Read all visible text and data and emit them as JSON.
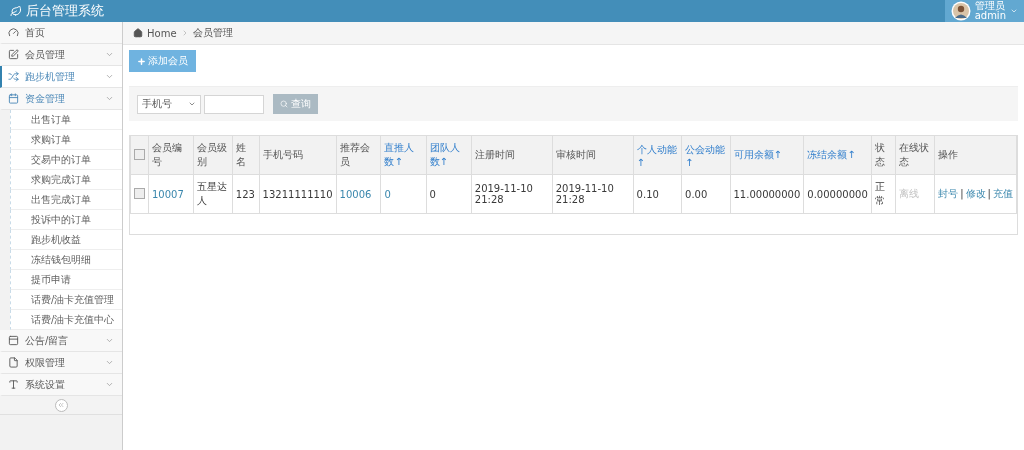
{
  "app": {
    "title": "后台管理系统"
  },
  "user": {
    "role": "管理员",
    "name": "admin"
  },
  "sidebar": {
    "items": [
      {
        "label": "首页",
        "selected": false
      },
      {
        "label": "会员管理",
        "selected": false,
        "expanded": false
      },
      {
        "label": "跑步机管理",
        "selected": true,
        "expanded": false
      },
      {
        "label": "资金管理",
        "selected": false,
        "expanded": true,
        "children": [
          {
            "label": "出售订单"
          },
          {
            "label": "求购订单"
          },
          {
            "label": "交易中的订单"
          },
          {
            "label": "求购完成订单"
          },
          {
            "label": "出售完成订单"
          },
          {
            "label": "投诉中的订单"
          },
          {
            "label": "跑步机收益"
          },
          {
            "label": "冻结钱包明细"
          },
          {
            "label": "提币申请"
          },
          {
            "label": "话费/油卡充值管理"
          },
          {
            "label": "话费/油卡充值中心"
          }
        ]
      },
      {
        "label": "公告/留言",
        "selected": false,
        "expanded": false
      },
      {
        "label": "权限管理",
        "selected": false,
        "expanded": false
      },
      {
        "label": "系统设置",
        "selected": false,
        "expanded": false
      }
    ]
  },
  "breadcrumb": [
    "Home",
    "会员管理"
  ],
  "add_button": "添加会员",
  "search": {
    "field": "手机号",
    "button": "查询"
  },
  "table": {
    "select_all": {
      "checked": false
    },
    "columns": [
      {
        "label": "会员编号",
        "sortable": false
      },
      {
        "label": "会员级别",
        "sortable": false
      },
      {
        "label": "姓名",
        "sortable": false
      },
      {
        "label": "手机号码",
        "sortable": false
      },
      {
        "label": "推荐会员",
        "sortable": false
      },
      {
        "label": "直推人数↑",
        "sortable": true
      },
      {
        "label": "团队人数↑",
        "sortable": true
      },
      {
        "label": "注册时间",
        "sortable": false
      },
      {
        "label": "审核时间",
        "sortable": false
      },
      {
        "label": "个人动能↑",
        "sortable": true
      },
      {
        "label": "公会动能↑",
        "sortable": true
      },
      {
        "label": "可用余额↑",
        "sortable": true
      },
      {
        "label": "冻结余额↑",
        "sortable": true
      },
      {
        "label": "状态",
        "sortable": false
      },
      {
        "label": "在线状态",
        "sortable": false
      },
      {
        "label": "操作",
        "sortable": false
      }
    ],
    "rows": [
      {
        "checked": false,
        "cells": [
          {
            "kind": "link",
            "text": "10007"
          },
          {
            "kind": "text",
            "text": "五星达人"
          },
          {
            "kind": "text",
            "text": "123"
          },
          {
            "kind": "text",
            "text": "13211111110"
          },
          {
            "kind": "link",
            "text": "10006"
          },
          {
            "kind": "link",
            "text": "0"
          },
          {
            "kind": "text",
            "text": "0"
          },
          {
            "kind": "text",
            "text": "2019-11-10 21:28"
          },
          {
            "kind": "text",
            "text": "2019-11-10 21:28"
          },
          {
            "kind": "text",
            "text": "0.10"
          },
          {
            "kind": "text",
            "text": "0.00"
          },
          {
            "kind": "text",
            "text": "11.00000000"
          },
          {
            "kind": "text",
            "text": "0.00000000"
          },
          {
            "kind": "text",
            "text": "正常"
          },
          {
            "kind": "muted",
            "text": "离线"
          },
          {
            "kind": "actions",
            "separator": "|",
            "actions": [
              "封号",
              "修改",
              "充值"
            ]
          }
        ]
      }
    ]
  }
}
